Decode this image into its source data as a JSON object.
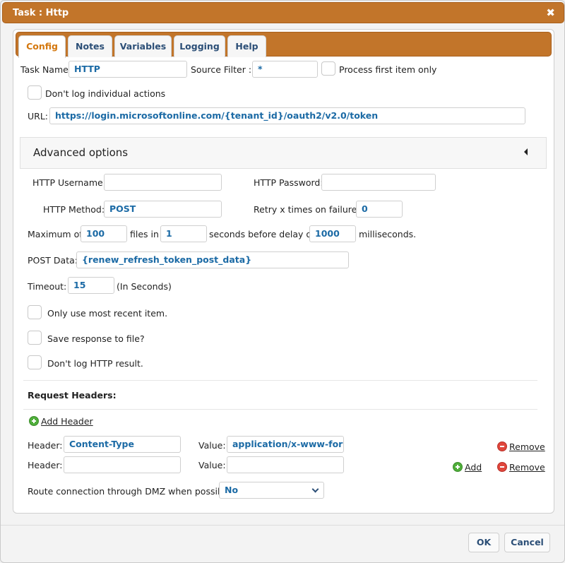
{
  "window": {
    "title": "Task : Http",
    "close_glyph": "✖"
  },
  "tabs": [
    {
      "label": "Config",
      "active": true
    },
    {
      "label": "Notes"
    },
    {
      "label": "Variables"
    },
    {
      "label": "Logging"
    },
    {
      "label": "Help"
    }
  ],
  "config": {
    "task_name_label": "Task Name:",
    "task_name_value": "HTTP",
    "source_filter_label": "Source Filter :",
    "source_filter_value": "*",
    "process_first_label": "Process first item only",
    "dont_log_individual_label": "Don't log individual actions",
    "url_label": "URL:",
    "url_value": "https://login.microsoftonline.com/{tenant_id}/oauth2/v2.0/token"
  },
  "advanced": {
    "title": "Advanced options",
    "http_username_label": "HTTP Username:",
    "http_username_value": "",
    "http_password_label": "HTTP Password:",
    "http_password_value": "",
    "http_method_label": "HTTP Method:",
    "http_method_value": "POST",
    "retry_label": "Retry x times on failure:",
    "retry_value": "0",
    "maximum_of_label": "Maximum of",
    "maximum_of_value": "100",
    "files_in_label": "files in",
    "files_in_value": "1",
    "seconds_before_label": "seconds before delay of",
    "delay_value": "1000",
    "milliseconds_label": "milliseconds.",
    "post_data_label": "POST Data:",
    "post_data_value": "{renew_refresh_token_post_data}",
    "timeout_label": "Timeout:",
    "timeout_value": "15",
    "timeout_unit": "(In Seconds)",
    "only_recent_label": "Only use most recent item.",
    "save_response_label": "Save response to file?",
    "dont_log_http_label": "Don't log HTTP result."
  },
  "headers": {
    "section_title": "Request Headers:",
    "add_header_label": "Add Header",
    "header_label": "Header:",
    "value_label": "Value:",
    "rows": [
      {
        "header": "Content-Type",
        "value": "application/x-www-form-u"
      },
      {
        "header": "",
        "value": ""
      }
    ],
    "add_label": "Add",
    "remove_label": "Remove"
  },
  "dmz": {
    "label": "Route connection through DMZ when possible:",
    "value": "No"
  },
  "buttons": {
    "ok": "OK",
    "cancel": "Cancel"
  },
  "colors": {
    "accent": "#c2752a",
    "active_tab": "#d4780f",
    "value_text": "#1b6aa5",
    "add_icon": "#4fae3a",
    "remove_icon": "#e0463c"
  },
  "icons": {
    "close": "close-icon",
    "add": "add-icon",
    "remove": "remove-icon",
    "collapse": "caret-left-icon",
    "dropdown": "chevron-down-icon"
  }
}
